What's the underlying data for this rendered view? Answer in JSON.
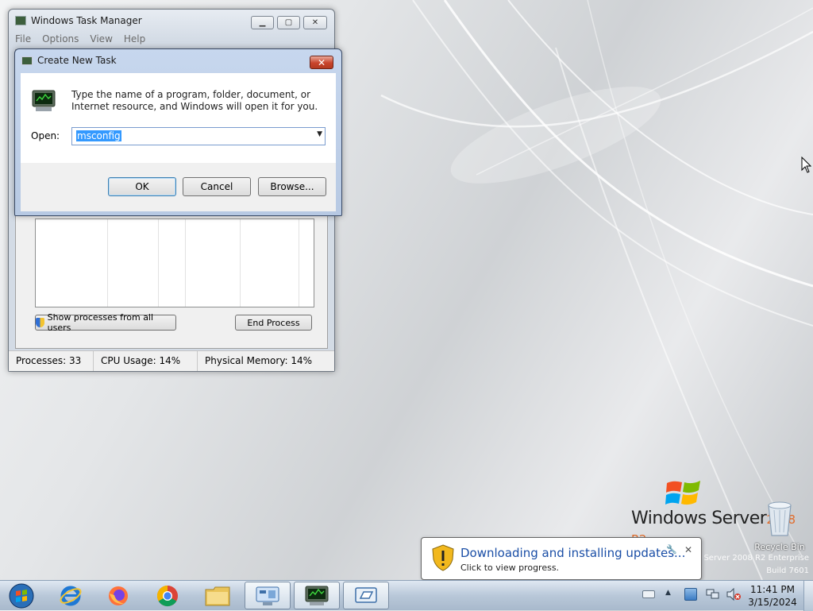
{
  "task_manager": {
    "title": "Windows Task Manager",
    "menu": [
      "File",
      "Options",
      "View",
      "Help"
    ],
    "show_processes_button": "Show processes from all users",
    "end_process_button": "End Process",
    "status": {
      "processes": "Processes: 33",
      "cpu": "CPU Usage: 14%",
      "memory": "Physical Memory: 14%"
    }
  },
  "dialog": {
    "title": "Create New Task",
    "description": "Type the name of a program, folder, document, or Internet resource, and Windows will open it for you.",
    "open_label": "Open:",
    "open_value": "msconfig",
    "ok_label": "OK",
    "cancel_label": "Cancel",
    "browse_label": "Browse..."
  },
  "notification": {
    "title": "Downloading and installing updates...",
    "subtitle": "Click to view progress."
  },
  "desktop": {
    "os_logo_text": "Windows Server",
    "os_logo_year": "2008 R2",
    "recycle_bin_label": "Recycle Bin",
    "edition_lines": [
      "Windows Server 2008 R2 Enterprise",
      "Build 7601"
    ]
  },
  "taskbar": {
    "items": [
      {
        "icon": "start-orb"
      },
      {
        "icon": "internet-explorer-icon"
      },
      {
        "icon": "firefox-icon"
      },
      {
        "icon": "chrome-icon"
      },
      {
        "icon": "file-explorer-icon"
      },
      {
        "icon": "server-manager-icon"
      },
      {
        "icon": "task-manager-icon"
      },
      {
        "icon": "remote-desktop-icon"
      }
    ],
    "clock_time": "11:41 PM",
    "clock_date": "3/15/2024"
  },
  "colors": {
    "selection": "#3399ff",
    "link_blue": "#1a4ea6",
    "close_red": "#c9442b"
  }
}
